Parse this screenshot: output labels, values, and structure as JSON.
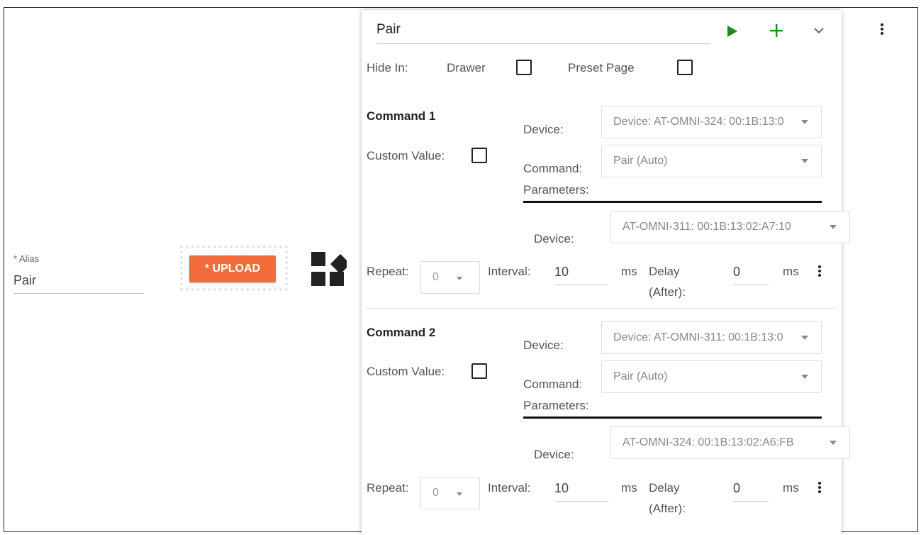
{
  "alias": {
    "label": "* Alias",
    "value": "Pair"
  },
  "upload": {
    "label": "* UPLOAD"
  },
  "card": {
    "title": "Pair",
    "hide_in_label": "Hide In:",
    "drawer_label": "Drawer",
    "preset_page_label": "Preset Page",
    "accent_color": "#1e8a1e"
  },
  "commands": [
    {
      "title": "Command 1",
      "custom_value_label": "Custom Value:",
      "device_label": "Device:",
      "device_value": "Device: AT-OMNI-324: 00:1B:13:0",
      "command_label": "Command:",
      "command_value": "Pair (Auto)",
      "parameters_label": "Parameters:",
      "param_device_label": "Device:",
      "param_device_value": "AT-OMNI-311: 00:1B:13:02:A7:10",
      "repeat_label": "Repeat:",
      "repeat_value": "0",
      "interval_label": "Interval:",
      "interval_value": "10",
      "ms_label": "ms",
      "delay_label": "Delay",
      "after_label": "(After):",
      "delay_value": "0",
      "ms2_label": "ms"
    },
    {
      "title": "Command 2",
      "custom_value_label": "Custom Value:",
      "device_label": "Device:",
      "device_value": "Device: AT-OMNI-311: 00:1B:13:0",
      "command_label": "Command:",
      "command_value": "Pair (Auto)",
      "parameters_label": "Parameters:",
      "param_device_label": "Device:",
      "param_device_value": "AT-OMNI-324: 00:1B:13:02:A6:FB",
      "repeat_label": "Repeat:",
      "repeat_value": "0",
      "interval_label": "Interval:",
      "interval_value": "10",
      "ms_label": "ms",
      "delay_label": "Delay",
      "after_label": "(After):",
      "delay_value": "0",
      "ms2_label": "ms"
    }
  ],
  "icons": {
    "play": "play-icon",
    "add": "plus-icon",
    "collapse": "chevron-down-icon",
    "menu": "more-vertical-icon",
    "widget": "widgets-icon"
  }
}
